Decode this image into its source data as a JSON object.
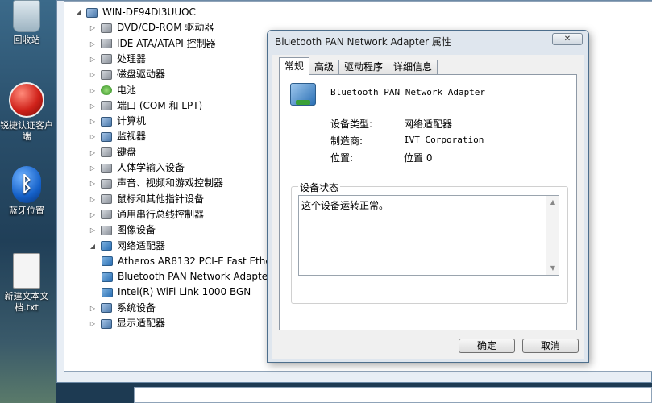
{
  "desktop": {
    "icons": [
      {
        "label": "回收站"
      },
      {
        "label": "锐捷认证客户端"
      },
      {
        "label": "蓝牙位置"
      },
      {
        "label": "新建文本文档.txt"
      }
    ]
  },
  "device_manager": {
    "root": "WIN-DF94DI3UUOC",
    "tree": [
      {
        "label": "DVD/CD-ROM 驱动器",
        "expander": "▷"
      },
      {
        "label": "IDE ATA/ATAPI 控制器",
        "expander": "▷"
      },
      {
        "label": "处理器",
        "expander": "▷"
      },
      {
        "label": "磁盘驱动器",
        "expander": "▷"
      },
      {
        "label": "电池",
        "expander": "▷"
      },
      {
        "label": "端口 (COM 和 LPT)",
        "expander": "▷"
      },
      {
        "label": "计算机",
        "expander": "▷"
      },
      {
        "label": "监视器",
        "expander": "▷"
      },
      {
        "label": "键盘",
        "expander": "▷"
      },
      {
        "label": "人体学输入设备",
        "expander": "▷"
      },
      {
        "label": "声音、视频和游戏控制器",
        "expander": "▷"
      },
      {
        "label": "鼠标和其他指针设备",
        "expander": "▷"
      },
      {
        "label": "通用串行总线控制器",
        "expander": "▷"
      },
      {
        "label": "图像设备",
        "expander": "▷"
      },
      {
        "label": "网络适配器",
        "expander": "◢"
      },
      {
        "label": "Atheros AR8132 PCI-E Fast Ethe",
        "expander": ""
      },
      {
        "label": "Bluetooth PAN Network Adapte",
        "expander": ""
      },
      {
        "label": "Intel(R) WiFi Link 1000 BGN",
        "expander": ""
      },
      {
        "label": "系统设备",
        "expander": "▷"
      },
      {
        "label": "显示适配器",
        "expander": "▷"
      }
    ]
  },
  "dialog": {
    "title": "Bluetooth PAN Network Adapter 属性",
    "close_label": "✕",
    "tabs": [
      "常规",
      "高级",
      "驱动程序",
      "详细信息"
    ],
    "device_name": "Bluetooth PAN Network Adapter",
    "properties": [
      {
        "label": "设备类型:",
        "value": "网络适配器"
      },
      {
        "label": "制造商:",
        "value": "IVT Corporation"
      },
      {
        "label": "位置:",
        "value": "位置 0"
      }
    ],
    "status_title": "设备状态",
    "status_text": "这个设备运转正常。",
    "ok_label": "确定",
    "cancel_label": "取消"
  }
}
